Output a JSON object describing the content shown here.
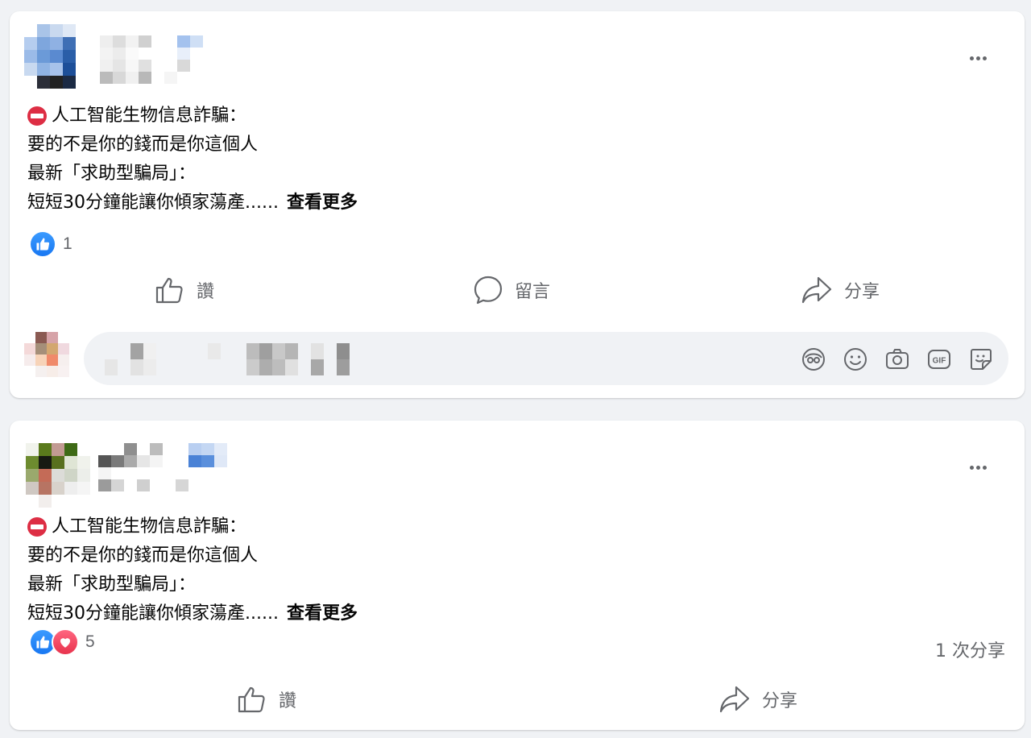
{
  "posts": [
    {
      "text_lines": [
        "人工智能生物信息詐騙：",
        "要的不是你的錢而是你這個人",
        "最新「求助型騙局」：",
        "短短30分鐘能讓你傾家蕩產......"
      ],
      "see_more": "查看更多",
      "reaction_count": "1",
      "reactions": [
        "like-icon"
      ],
      "actions": {
        "like": "讚",
        "comment": "留言",
        "share": "分享"
      },
      "share_count": ""
    },
    {
      "text_lines": [
        "人工智能生物信息詐騙：",
        "要的不是你的錢而是你這個人",
        "最新「求助型騙局」：",
        "短短30分鐘能讓你傾家蕩產......"
      ],
      "see_more": "查看更多",
      "reaction_count": "5",
      "reactions": [
        "like-icon",
        "love-icon"
      ],
      "actions": {
        "like": "讚",
        "share": "分享"
      },
      "share_count": "1 次分享"
    }
  ],
  "comment_icons": [
    "avatar-sticker-icon",
    "emoji-icon",
    "camera-icon",
    "gif-icon",
    "sticker-icon"
  ],
  "colors": {
    "background": "#f0f2f5",
    "card": "#ffffff",
    "secondary_text": "#65676b",
    "like_blue": "#1877f2",
    "love_red": "#e8334d"
  }
}
